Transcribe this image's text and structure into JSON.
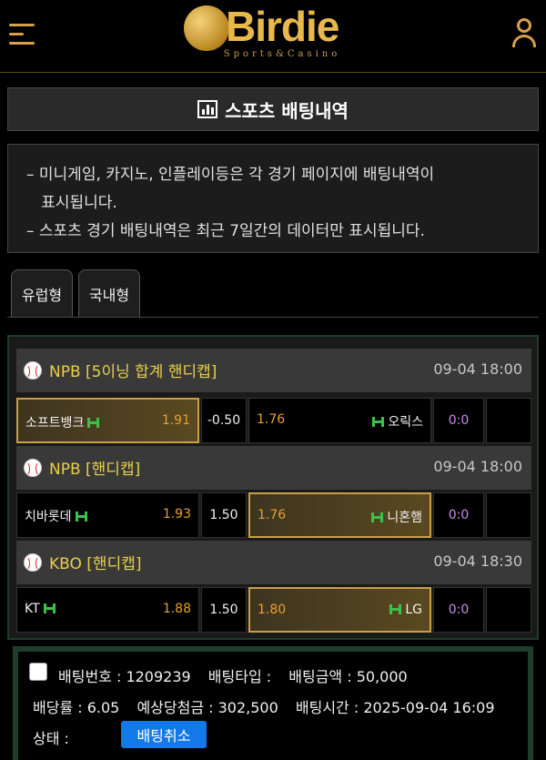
{
  "header": {
    "logo_text": "Birdie",
    "logo_sub": "Sports&Casino",
    "menu_icon": "hamburger-icon",
    "user_icon": "user-icon"
  },
  "page": {
    "title": "스포츠 배팅내역",
    "title_icon": "bar-chart-icon"
  },
  "notice": {
    "line1": "– 미니게임, 카지노, 인플레이등은 각 경기 페이지에 배팅내역이",
    "line1b": "   표시됩니다.",
    "line2": "– 스포츠 경기 배팅내역은 최근 7일간의 데이터만 표시됩니다."
  },
  "tabs": [
    {
      "label": "유럽형"
    },
    {
      "label": "국내형"
    }
  ],
  "matches": [
    {
      "league": "NPB [5이닝 합계 핸디캡]",
      "time": "09-04 18:00",
      "home": "소프트뱅크",
      "home_odds": "1.91",
      "line": "-0.50",
      "away": "오릭스",
      "away_odds": "1.76",
      "score": "0:0",
      "selected": "home"
    },
    {
      "league": "NPB [핸디캡]",
      "time": "09-04 18:00",
      "home": "치바롯데",
      "home_odds": "1.93",
      "line": "1.50",
      "away": "니혼햄",
      "away_odds": "1.76",
      "score": "0:0",
      "selected": "away"
    },
    {
      "league": "KBO [핸디캡]",
      "time": "09-04 18:30",
      "home": "KT",
      "home_odds": "1.88",
      "line": "1.50",
      "away": "LG",
      "away_odds": "1.80",
      "score": "0:0",
      "selected": "away"
    }
  ],
  "summary": {
    "bet_no": "배팅번호 : 1209239",
    "bet_type": "배팅타입 :",
    "bet_amount": "배팅금액 : 50,000",
    "odds": "배당률 : 6.05",
    "expected": "예상당첨금 : 302,500",
    "bet_time": "배팅시간 : 2025-09-04 16:09",
    "status": "상태 :",
    "cancel_label": "배팅취소"
  },
  "colors": {
    "accent_gold": "#c9a04a",
    "league_yellow": "#e8d04a",
    "odds_orange": "#e8a030",
    "score_purple": "#c98be8",
    "home_away_icon_green": "#3cc04a",
    "cancel_blue": "#1479e8"
  }
}
